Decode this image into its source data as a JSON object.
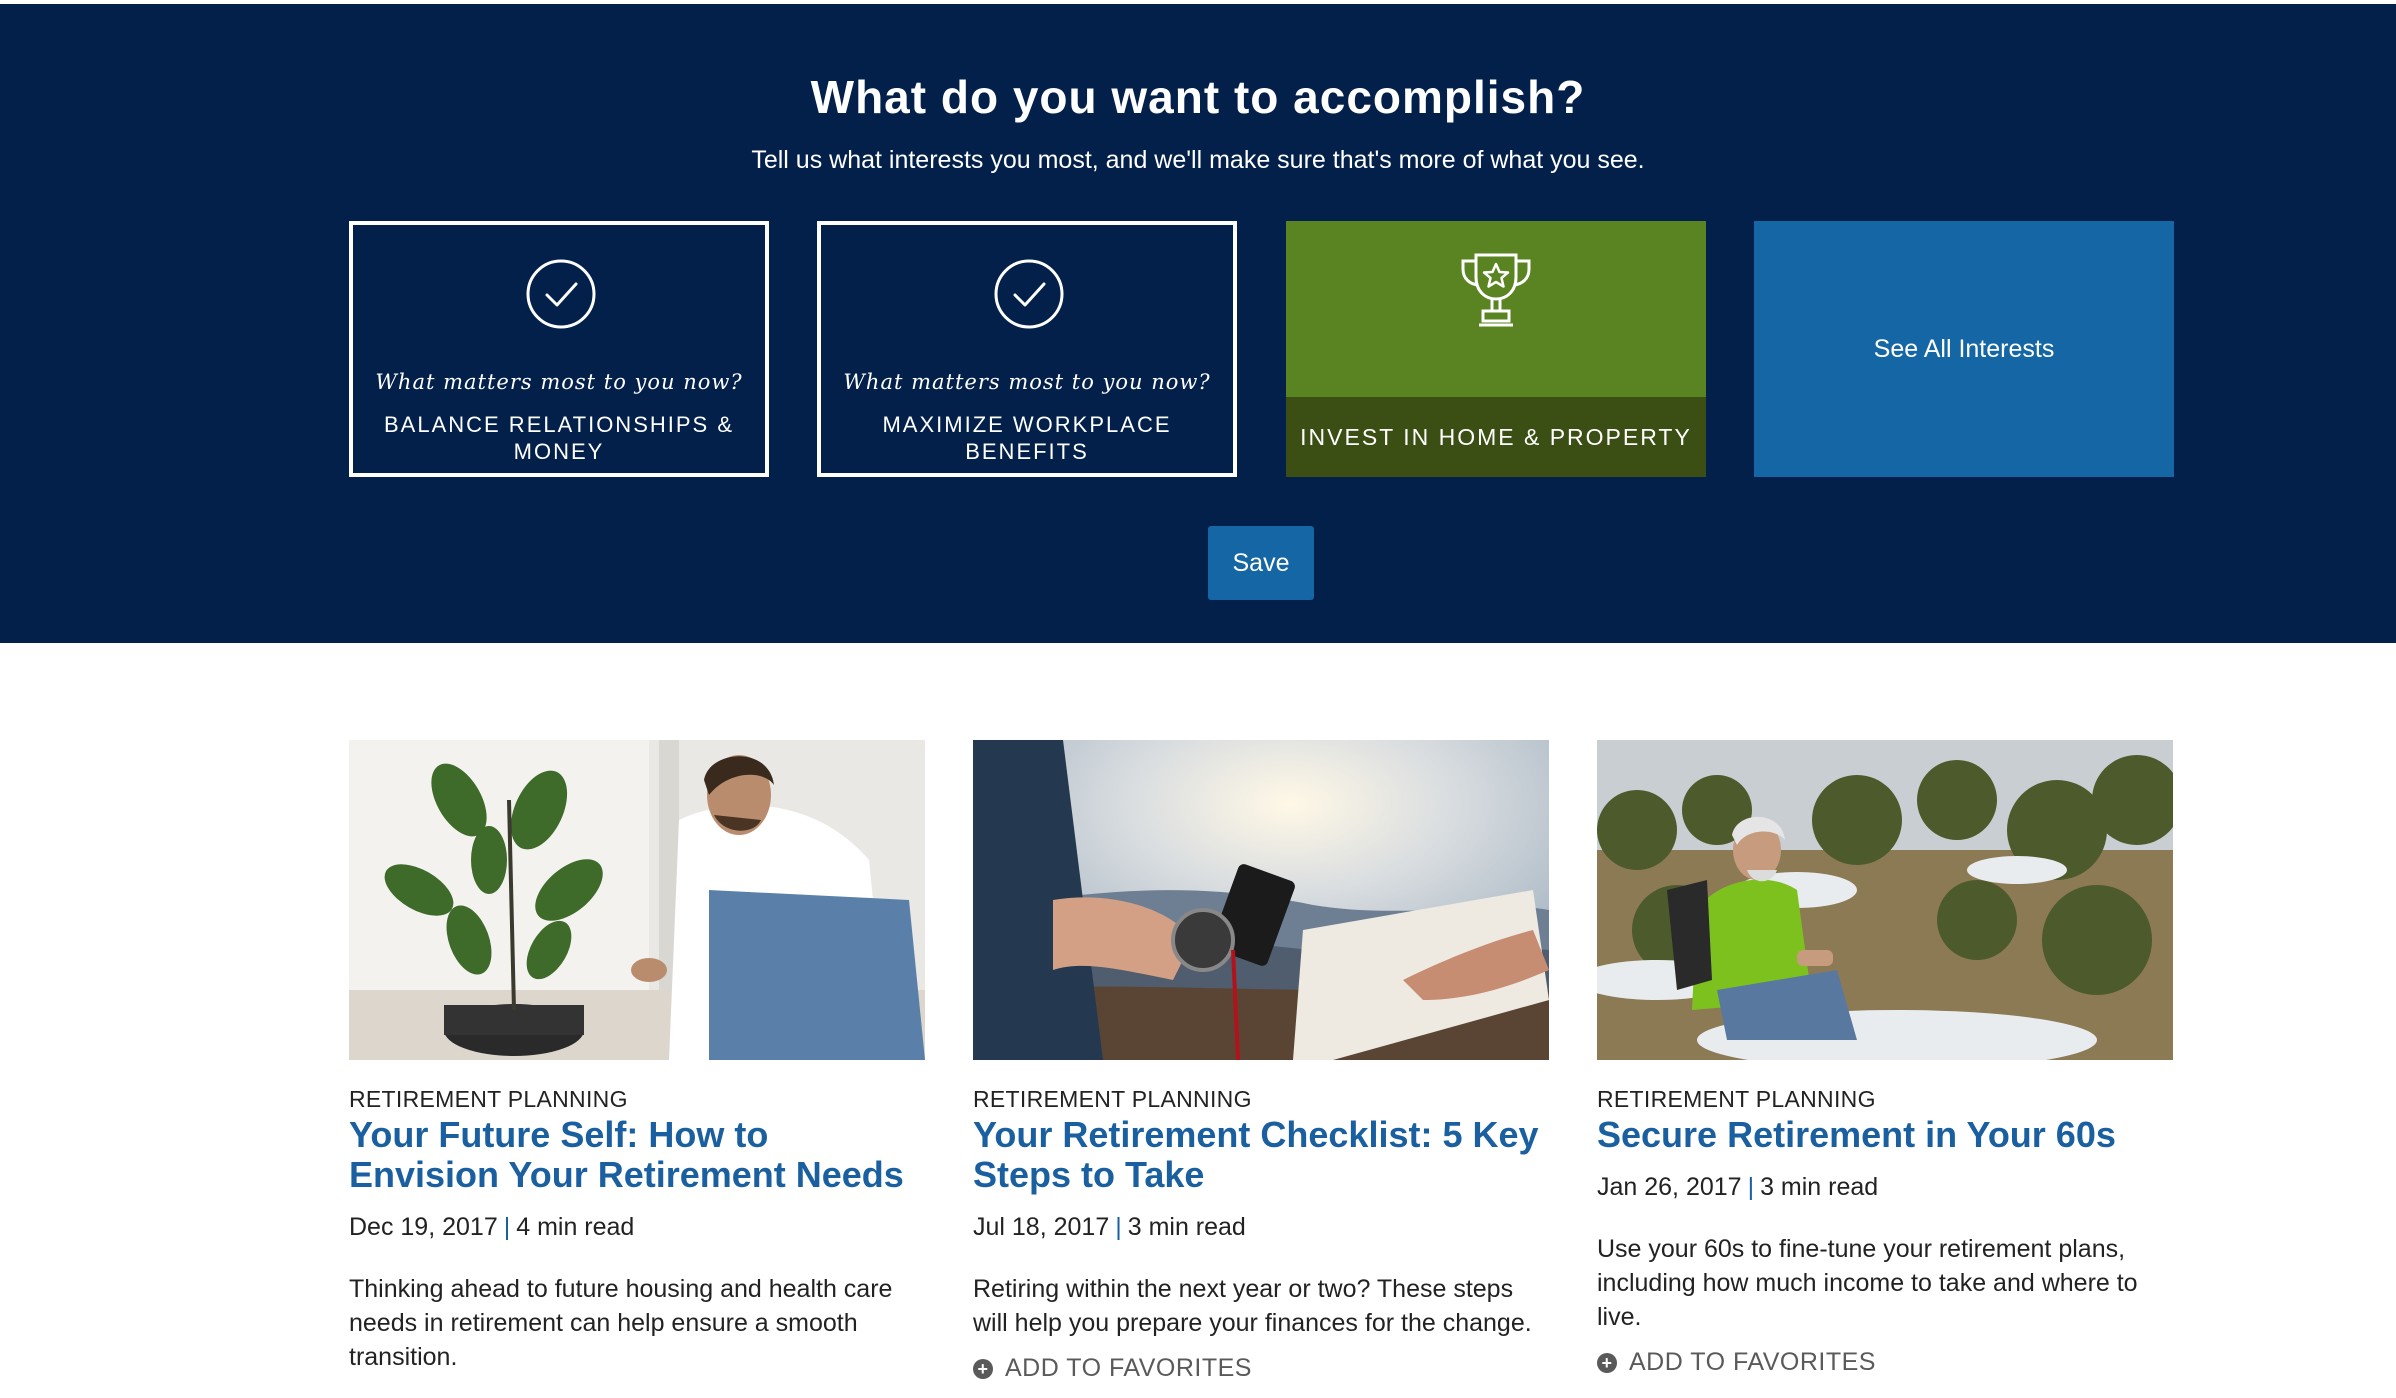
{
  "hero": {
    "title": "What do you want to accomplish?",
    "subtitle": "Tell us what interests you most, and we'll make sure that's more of what you see.",
    "background_color": "#02204a",
    "cards": [
      {
        "prompt": "What matters most to you now?",
        "label": "BALANCE RELATIONSHIPS & MONEY",
        "state": "selected",
        "icon": "check-circle-icon"
      },
      {
        "prompt": "What matters most to you now?",
        "label": "MAXIMIZE WORKPLACE BENEFITS",
        "state": "selected",
        "icon": "check-circle-icon"
      },
      {
        "label": "INVEST IN HOME & PROPERTY",
        "state": "highlighted",
        "icon": "trophy-icon",
        "color": "#5a8321"
      },
      {
        "label": "See All Interests",
        "color": "#1566a4"
      }
    ],
    "save_label": "Save"
  },
  "articles": [
    {
      "category": "RETIREMENT PLANNING",
      "title": "Your Future Self: How to Envision Your Retirement Needs",
      "date": "Dec 19, 2017",
      "read_time": "4 min read",
      "description": "Thinking ahead to future housing and health care needs in retirement can help ensure a smooth transition.",
      "image": "man-with-plant-photo"
    },
    {
      "category": "RETIREMENT PLANNING",
      "title": "Your Retirement Checklist: 5 Key Steps to Take",
      "date": "Jul 18, 2017",
      "read_time": "3 min read",
      "description": "Retiring within the next year or two? These steps will help you prepare your finances for the change.",
      "favorite_label": "ADD TO FAVORITES",
      "image": "compass-and-map-photo"
    },
    {
      "category": "RETIREMENT PLANNING",
      "title": "Secure Retirement in Your 60s",
      "date": "Jan 26, 2017",
      "read_time": "3 min read",
      "description": "Use your 60s to fine-tune your retirement plans, including how much income to take and where to live.",
      "favorite_label": "ADD TO FAVORITES",
      "image": "hiker-in-mountains-photo"
    }
  ],
  "colors": {
    "accent": "#1566a4",
    "link": "#1a5f9f"
  }
}
